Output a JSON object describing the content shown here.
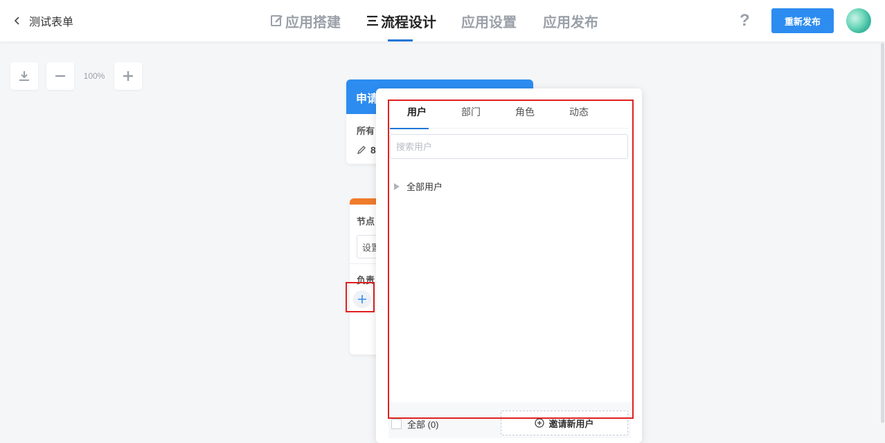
{
  "header": {
    "back_title": "测试表单",
    "tabs": [
      {
        "label": "应用搭建",
        "active": false
      },
      {
        "label": "流程设计",
        "active": true
      },
      {
        "label": "应用设置",
        "active": false
      },
      {
        "label": "应用发布",
        "active": false
      }
    ],
    "help_label": "?",
    "republish_label": "重新发布"
  },
  "toolbar": {
    "zoom_level": "100%"
  },
  "canvas": {
    "start_node": {
      "title": "申请",
      "subtitle": "所有",
      "edit_value": "8"
    },
    "approval_node": {
      "field_label": "节点",
      "input_value": "设置",
      "assignee_label": "负责"
    }
  },
  "popover": {
    "tabs": [
      "用户",
      "部门",
      "角色",
      "动态"
    ],
    "active_tab": "用户",
    "search_placeholder": "搜索用户",
    "tree_root_label": "全部用户",
    "select_all_label": "全部 (0)",
    "invite_label": "邀请新用户"
  },
  "colors": {
    "primary": "#2d8cf0",
    "tab_active_underline": "#1f75d8",
    "approval_accent": "#f07b2c",
    "highlight": "#e02020"
  }
}
